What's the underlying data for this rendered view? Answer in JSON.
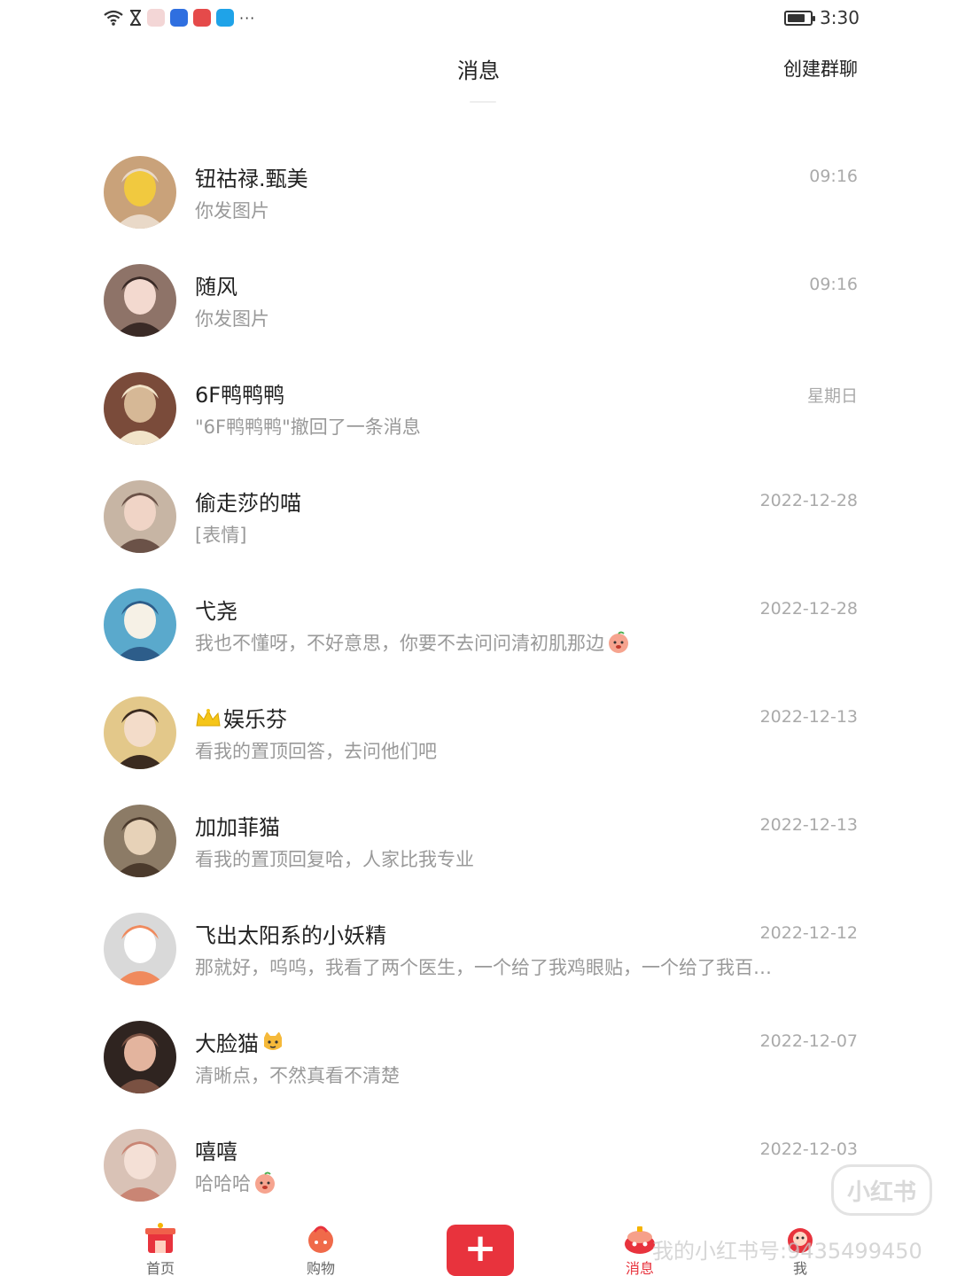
{
  "status_bar": {
    "time": "3:30",
    "icons": [
      "wifi-icon",
      "hourglass-icon",
      "envelope-app-icon",
      "blue-app-icon",
      "red-app-icon",
      "search-app-icon"
    ],
    "more": "···",
    "battery_level": 0.8
  },
  "header": {
    "title": "消息",
    "create_group": "创建群聊"
  },
  "chats": [
    {
      "name": "钮祜禄.甄美",
      "preview": "你发图片",
      "time": "09:16",
      "avatar_colors": [
        "#c9a27a",
        "#f1c93f",
        "#e9d9c8"
      ]
    },
    {
      "name": "随风",
      "preview": "你发图片",
      "time": "09:16",
      "avatar_colors": [
        "#8e7368",
        "#f3d9cf",
        "#3a2a26"
      ]
    },
    {
      "name": "6F鸭鸭鸭",
      "preview": "\"6F鸭鸭鸭\"撤回了一条消息",
      "time": "星期日",
      "avatar_colors": [
        "#7a4b3a",
        "#d6b896",
        "#f2e4c9"
      ]
    },
    {
      "name": "偷走莎的喵",
      "preview": "[表情]",
      "time": "2022-12-28",
      "avatar_colors": [
        "#c7b5a4",
        "#f0d4c6",
        "#6b5248"
      ]
    },
    {
      "name": "弋尧",
      "preview": "我也不懂呀，不好意思，你要不去问问清初肌那边",
      "preview_emoji": "peach-emoji-icon",
      "time": "2022-12-28",
      "avatar_colors": [
        "#5aa9cc",
        "#f6f1e6",
        "#2d5d8a"
      ]
    },
    {
      "name": "娱乐芬",
      "name_prefix_icon": "crown-icon",
      "preview": "看我的置顶回答，去问他们吧",
      "time": "2022-12-13",
      "avatar_colors": [
        "#e3c88a",
        "#f3dcc9",
        "#3b2b20"
      ]
    },
    {
      "name": "加加菲猫",
      "preview": "看我的置顶回复哈，人家比我专业",
      "time": "2022-12-13",
      "avatar_colors": [
        "#8c7b66",
        "#e7d2b8",
        "#4b3a2c"
      ]
    },
    {
      "name": "飞出太阳系的小妖精",
      "preview": "那就好，呜呜，我看了两个医生，一个给了我鸡眼贴，一个给了我百…",
      "time": "2022-12-12",
      "avatar_colors": [
        "#d9d9d9",
        "#ffffff",
        "#f08a5d"
      ]
    },
    {
      "name": "大脸猫",
      "name_suffix_icon": "cat-face-emoji-icon",
      "preview": "清晰点，不然真看不清楚",
      "time": "2022-12-07",
      "avatar_colors": [
        "#2f2420",
        "#e3b49e",
        "#7a5142"
      ]
    },
    {
      "name": "嘻嘻",
      "preview": "哈哈哈",
      "preview_emoji": "peach-emoji-icon",
      "time": "2022-12-03",
      "avatar_colors": [
        "#d9c2b6",
        "#f4e0d6",
        "#c98574"
      ]
    }
  ],
  "tab_bar": {
    "tabs": [
      {
        "label": "首页",
        "icon": "home-icon",
        "active": false
      },
      {
        "label": "购物",
        "icon": "shopping-icon",
        "active": false
      },
      {
        "label": "消息",
        "icon": "message-icon",
        "active": true
      },
      {
        "label": "我",
        "icon": "profile-icon",
        "active": false
      }
    ],
    "publish_label": "+"
  },
  "watermark": {
    "text": "我的小红书号:9435499450",
    "badge": "小红书"
  },
  "colors": {
    "accent": "#e8333d",
    "title_text": "#222222",
    "preview_text": "#999999",
    "time_text": "#aaaaaa"
  }
}
